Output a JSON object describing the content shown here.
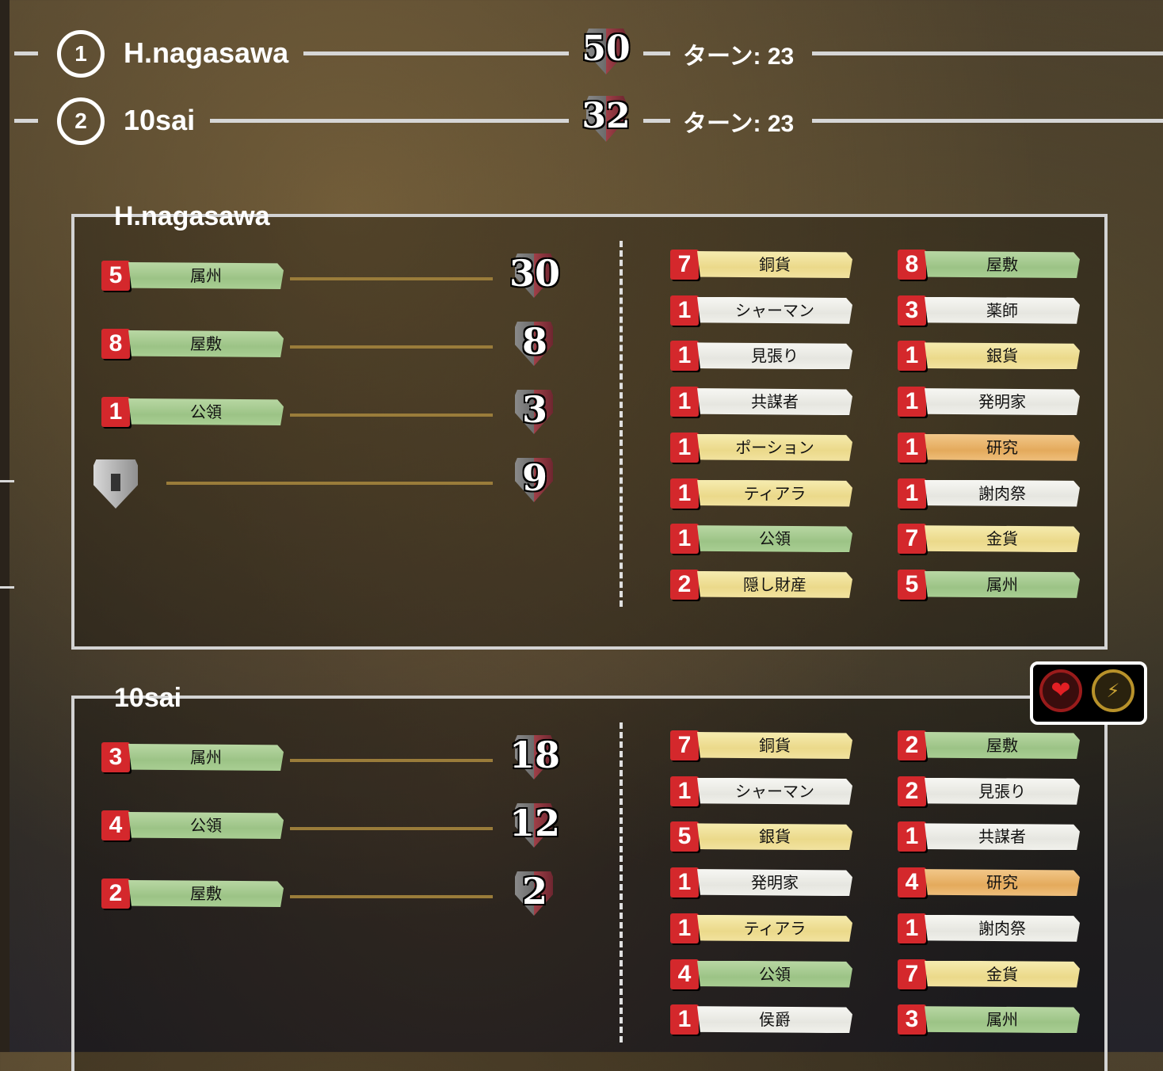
{
  "header": {
    "rows": [
      {
        "rank": "1",
        "name": "H.nagasawa",
        "score": "50",
        "turn": "ターン: 23"
      },
      {
        "rank": "2",
        "name": "10sai",
        "score": "32",
        "turn": "ターン: 23"
      }
    ]
  },
  "players": [
    {
      "name": "H.nagasawa",
      "summary": [
        {
          "count": "5",
          "label": "属州",
          "color": "green",
          "points": "30"
        },
        {
          "count": "8",
          "label": "屋敷",
          "color": "green",
          "points": "8"
        },
        {
          "count": "1",
          "label": "公領",
          "color": "green",
          "points": "3"
        },
        {
          "icon": "victory-token-icon",
          "points": "9"
        }
      ],
      "cards": [
        {
          "count": "7",
          "label": "銅貨",
          "color": "yellow"
        },
        {
          "count": "8",
          "label": "屋敷",
          "color": "green"
        },
        {
          "count": "1",
          "label": "シャーマン",
          "color": "white"
        },
        {
          "count": "3",
          "label": "薬師",
          "color": "white"
        },
        {
          "count": "1",
          "label": "見張り",
          "color": "white"
        },
        {
          "count": "1",
          "label": "銀貨",
          "color": "yellow"
        },
        {
          "count": "1",
          "label": "共謀者",
          "color": "white"
        },
        {
          "count": "1",
          "label": "発明家",
          "color": "white"
        },
        {
          "count": "1",
          "label": "ポーション",
          "color": "yellow"
        },
        {
          "count": "1",
          "label": "研究",
          "color": "orange"
        },
        {
          "count": "1",
          "label": "ティアラ",
          "color": "yellow"
        },
        {
          "count": "1",
          "label": "謝肉祭",
          "color": "white"
        },
        {
          "count": "1",
          "label": "公領",
          "color": "green"
        },
        {
          "count": "7",
          "label": "金貨",
          "color": "yellow"
        },
        {
          "count": "2",
          "label": "隠し財産",
          "color": "yellow"
        },
        {
          "count": "5",
          "label": "属州",
          "color": "green"
        }
      ]
    },
    {
      "name": "10sai",
      "summary": [
        {
          "count": "3",
          "label": "属州",
          "color": "green",
          "points": "18"
        },
        {
          "count": "4",
          "label": "公領",
          "color": "green",
          "points": "12"
        },
        {
          "count": "2",
          "label": "屋敷",
          "color": "green",
          "points": "2"
        }
      ],
      "cards": [
        {
          "count": "7",
          "label": "銅貨",
          "color": "yellow"
        },
        {
          "count": "2",
          "label": "屋敷",
          "color": "green"
        },
        {
          "count": "1",
          "label": "シャーマン",
          "color": "white"
        },
        {
          "count": "2",
          "label": "見張り",
          "color": "white"
        },
        {
          "count": "5",
          "label": "銀貨",
          "color": "yellow"
        },
        {
          "count": "1",
          "label": "共謀者",
          "color": "white"
        },
        {
          "count": "1",
          "label": "発明家",
          "color": "white"
        },
        {
          "count": "4",
          "label": "研究",
          "color": "orange"
        },
        {
          "count": "1",
          "label": "ティアラ",
          "color": "yellow"
        },
        {
          "count": "1",
          "label": "謝肉祭",
          "color": "white"
        },
        {
          "count": "4",
          "label": "公領",
          "color": "green"
        },
        {
          "count": "7",
          "label": "金貨",
          "color": "yellow"
        },
        {
          "count": "1",
          "label": "侯爵",
          "color": "white"
        },
        {
          "count": "3",
          "label": "属州",
          "color": "green"
        }
      ]
    }
  ],
  "buttons": {
    "heart": "heart-icon",
    "bolt": "bolt-icon"
  }
}
